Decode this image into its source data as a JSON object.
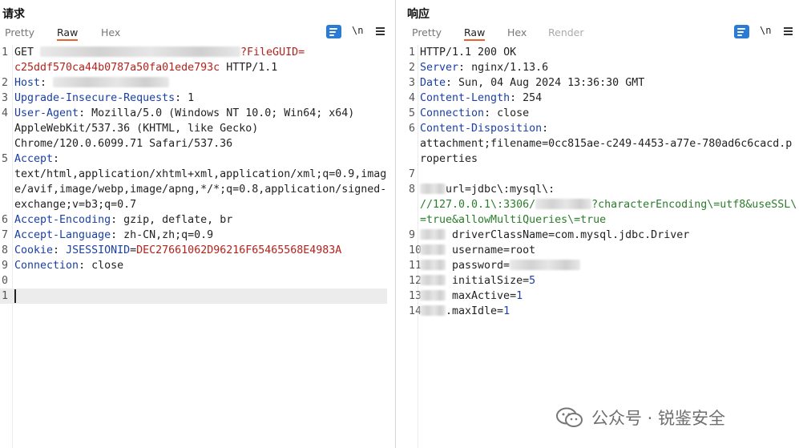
{
  "request": {
    "title": "请求",
    "tabs": [
      "Pretty",
      "Raw",
      "Hex"
    ],
    "active_tab": "Raw",
    "newline_label": "\\n",
    "lines": {
      "l1a_pre": "GET ",
      "l1a_post": "?FileGUID=",
      "l1b": "c25ddf570ca44b0787a50fa01ede793c",
      "l1b_post": " HTTP/1.1",
      "l2_key": "Host",
      "l3_key": "Upgrade-Insecure-Requests",
      "l3_val": " 1",
      "l4_key": "User-Agent",
      "l4_val": " Mozilla/5.0 (Windows NT 10.0; Win64; x64)",
      "l4b": "AppleWebKit/537.36 (KHTML, like Gecko)",
      "l4c": "Chrome/120.0.6099.71 Safari/537.36",
      "l5_key": "Accept",
      "l5b": "text/html,application/xhtml+xml,application/xml;q=0.9,imag",
      "l5c": "e/avif,image/webp,image/apng,*/*;q=0.8,application/signed-",
      "l5d": "exchange;v=b3;q=0.7",
      "l6_key": "Accept-Encoding",
      "l6_val": " gzip, deflate, br",
      "l7_key": "Accept-Language",
      "l7_val": " zh-CN,zh;q=0.9",
      "l8_key": "Cookie",
      "l8_ck": " JSESSIONID",
      "l8_cv": "DEC27661062D96216F65465568E4983A",
      "l9_key": "Connection",
      "l9_val": " close"
    },
    "line_numbers": [
      "1",
      "2",
      "3",
      "4",
      "5",
      "6",
      "7",
      "8",
      "9",
      "0",
      "1"
    ]
  },
  "response": {
    "title": "响应",
    "tabs": [
      "Pretty",
      "Raw",
      "Hex",
      "Render"
    ],
    "active_tab": "Raw",
    "newline_label": "\\n",
    "lines": {
      "l1": "HTTP/1.1 200 OK",
      "l2_key": "Server",
      "l2_val": " nginx/1.13.6",
      "l3_key": "Date",
      "l3_val": " Sun, 04 Aug 2024 13:36:30 GMT",
      "l4_key": "Content-Length",
      "l4_val": " 254",
      "l5_key": "Connection",
      "l5_val": " close",
      "l6_key": "Content-Disposition",
      "l6b": "attachment;filename=0cc815ae-c249-4453-a77e-780ad6c6cacd.p",
      "l6c": "roperties",
      "l8_pre": "url=jdbc\\:mysql\\:",
      "l8b_pre": "//127.0.0.1\\:3306/",
      "l8b_post": "?characterEncoding\\=utf8&useSSL\\",
      "l8c": "=true&allowMultiQueries\\=true",
      "l9": "driverClassName=com.mysql.jdbc.Driver",
      "l10": "username=root",
      "l11": "password=",
      "l12_pre": "initialSize=",
      "l12_num": "5",
      "l13_pre": "maxActive=",
      "l13_num": "1",
      "l14_pre": ".maxIdle=",
      "l14_num": "1"
    },
    "line_numbers": [
      "1",
      "2",
      "3",
      "4",
      "5",
      "6",
      "7",
      "8",
      "9",
      "10",
      "11",
      "12",
      "13",
      "14"
    ]
  },
  "watermark": {
    "text": "公众号 · 锐鉴安全"
  },
  "colors": {
    "accent": "#2b7bd6",
    "active_tab_underline": "#e8612c",
    "header_key": "#1a3fa8",
    "value_red": "#b5211b",
    "value_green": "#2a7d2a"
  }
}
